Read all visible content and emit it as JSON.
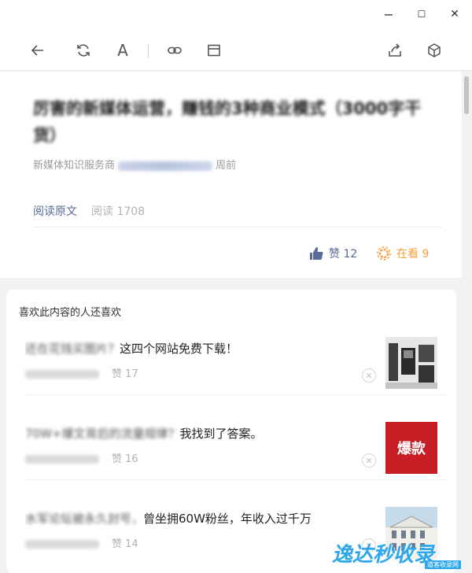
{
  "window": {
    "minimize": "−",
    "maximize": "☐",
    "close": "✕"
  },
  "toolbar": {
    "font_label": "A"
  },
  "article": {
    "title_clear_a": "厉害的新媒体运营，",
    "title_blur": "赚钱的3种商业模式",
    "title_clear_b": "（3000字干货）",
    "meta_source": "新媒体知识服务商",
    "meta_time": "周前",
    "read_original": "阅读原文",
    "read_count": "阅读 1708",
    "likes_label": "赞 12",
    "looking_label": "在看 9"
  },
  "recommendations": {
    "header": "喜欢此内容的人还喜欢",
    "items": [
      {
        "title_blur": "还在花钱买图片？",
        "title_clear": "这四个网站免费下载！",
        "likes": "赞 17",
        "close": "✕"
      },
      {
        "title_blur": "70W+爆文背后的流量规律？",
        "title_clear": "我找到了答案。",
        "likes": "赞 16",
        "thumb_text": "爆款",
        "close": "✕"
      },
      {
        "title_blur": "水军论坛被永久封号，",
        "title_clear": "曾坐拥60W粉丝，年收入过千万",
        "likes": "赞 14",
        "close": "✕"
      }
    ]
  },
  "watermark": {
    "text": "逸达秒收录",
    "sub": "道客收录网"
  },
  "colors": {
    "link_blue": "#576b95",
    "looking_orange": "#fa9d3b"
  }
}
